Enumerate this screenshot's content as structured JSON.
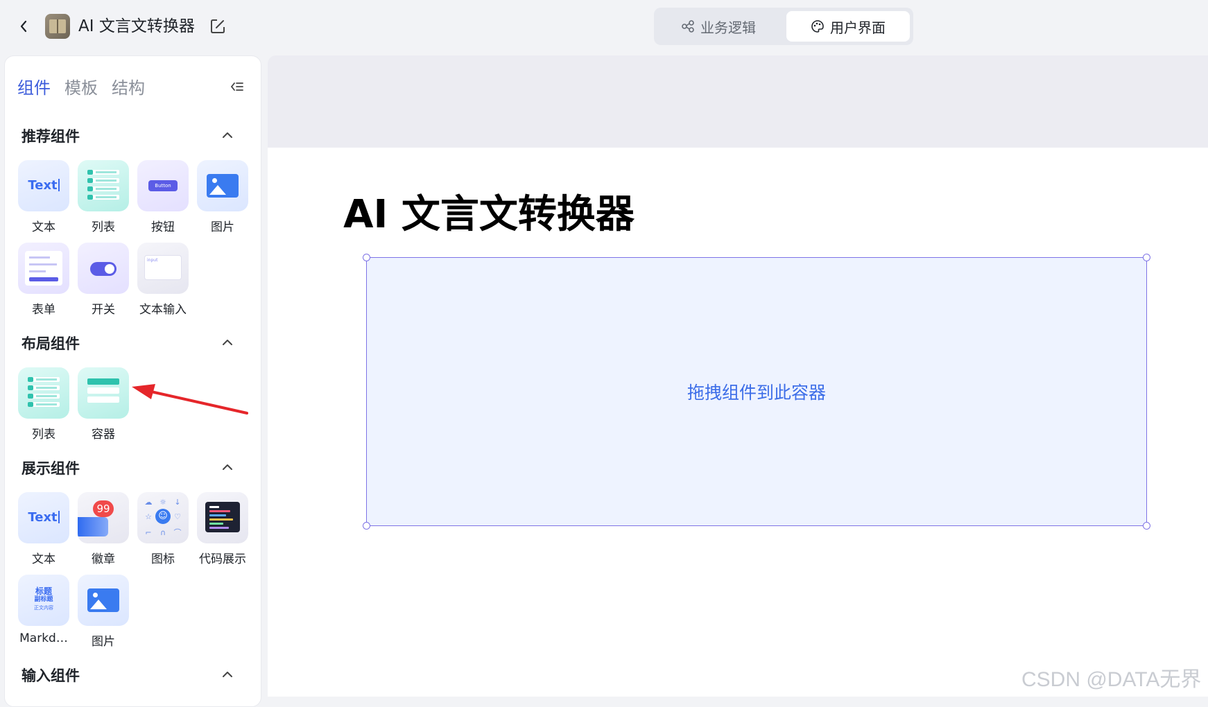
{
  "header": {
    "app_title": "AI 文言文转换器",
    "back_icon": "chevron-left-icon",
    "edit_icon": "edit-icon",
    "view_switch": [
      {
        "label": "业务逻辑",
        "icon": "flow-icon",
        "active": false
      },
      {
        "label": "用户界面",
        "icon": "palette-icon",
        "active": true
      }
    ]
  },
  "sidebar": {
    "tabs": [
      "组件",
      "模板",
      "结构"
    ],
    "active_tab": "组件",
    "collapse_icon": "collapse-panel-icon",
    "sections": [
      {
        "title": "推荐组件",
        "items": [
          "文本",
          "列表",
          "按钮",
          "图片",
          "表单",
          "开关",
          "文本输入"
        ]
      },
      {
        "title": "布局组件",
        "items": [
          "列表",
          "容器"
        ]
      },
      {
        "title": "展示组件",
        "items": [
          "文本",
          "徽章",
          "图标",
          "代码展示",
          "Markd…",
          "图片"
        ]
      },
      {
        "title": "输入组件",
        "items": []
      }
    ],
    "tile_text": {
      "text": "Text",
      "button": "Button",
      "input": "input",
      "badge": "99",
      "md_title": "标题",
      "md_subtitle": "副标题",
      "md_body": "正文内容"
    }
  },
  "canvas": {
    "page_title": "AI 文言文转换器",
    "dropzone_text": "拖拽组件到此容器"
  },
  "watermark": "CSDN @DATA无界",
  "colors": {
    "accent": "#3b5bdb",
    "selection_border": "#7d72e6",
    "dropzone_bg": "#eef3ff",
    "annotation_arrow": "#e5262a"
  }
}
